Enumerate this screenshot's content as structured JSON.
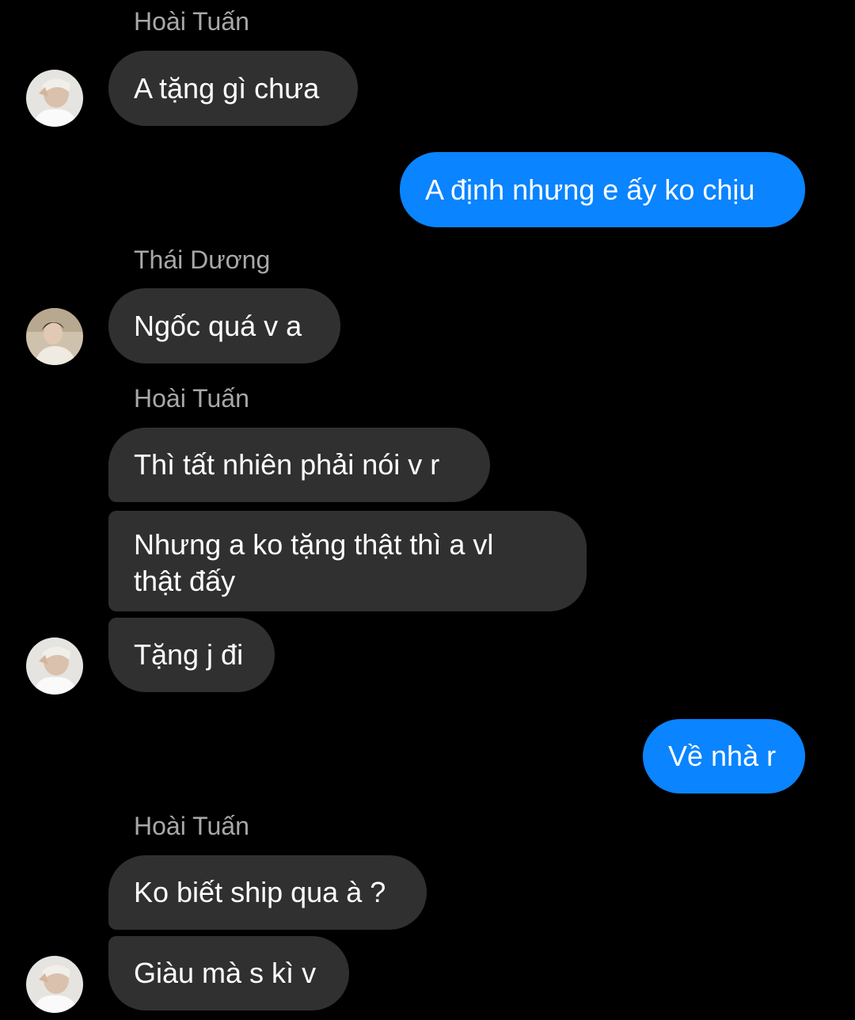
{
  "conversation": {
    "names": {
      "hoai_tuan_1": "Hoài Tuấn",
      "thai_duong": "Thái Dương",
      "hoai_tuan_2": "Hoài Tuấn",
      "hoai_tuan_3": "Hoài Tuấn"
    },
    "messages": {
      "m1": "A tặng gì chưa",
      "m2": "A định nhưng e ấy ko chịu",
      "m3": "Ngốc quá v a",
      "m4": "Thì tất nhiên phải nói v r",
      "m5": "Nhưng a ko tặng thật thì a vl thật đấy",
      "m6": "Tặng j đi",
      "m7": "Về nhà r",
      "m8": "Ko biết ship qua à ?",
      "m9": "Giàu mà s kì v"
    }
  },
  "colors": {
    "background": "#000000",
    "incoming_bubble": "#303030",
    "outgoing_bubble": "#0a84ff",
    "sender_name": "#a8a8a8"
  }
}
